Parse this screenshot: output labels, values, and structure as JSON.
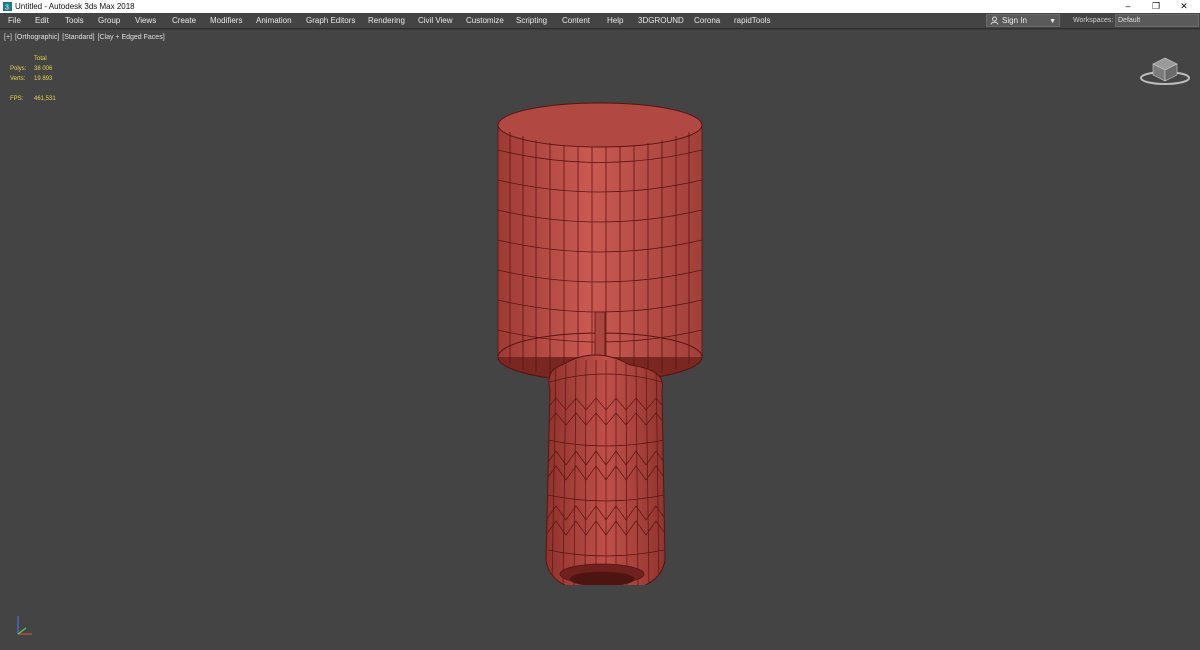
{
  "window": {
    "title": "Untitled - Autodesk 3ds Max 2018",
    "controls": {
      "minimize": "–",
      "restore": "❐",
      "close": "✕"
    }
  },
  "menubar": {
    "items": [
      "File",
      "Edit",
      "Tools",
      "Group",
      "Views",
      "Create",
      "Modifiers",
      "Animation",
      "Graph Editors",
      "Rendering",
      "Civil View",
      "Customize",
      "Scripting",
      "Content",
      "Help",
      "3DGROUND",
      "Corona",
      "rapidTools"
    ]
  },
  "account": {
    "sign_in_label": "Sign In"
  },
  "workspaces": {
    "label": "Workspaces:",
    "value": "Default"
  },
  "viewport": {
    "labels": [
      "[+]",
      "[Orthographic]",
      "[Standard]",
      "[Clay + Edged Faces]"
    ],
    "stats": {
      "header": "Total",
      "polys_label": "Polys:",
      "polys_value": "38 006",
      "verts_label": "Verts:",
      "verts_value": "19 893",
      "fps_label": "FPS:",
      "fps_value": "461,531"
    }
  },
  "colors": {
    "viewport_bg": "#444444",
    "mesh_fill": "#b84a44",
    "mesh_wire": "#5a1412",
    "stats_text": "#e8d74a"
  },
  "icons": [
    "app-icon",
    "user-icon",
    "chevron-down-icon",
    "viewcube-icon",
    "axis-gizmo-icon"
  ]
}
